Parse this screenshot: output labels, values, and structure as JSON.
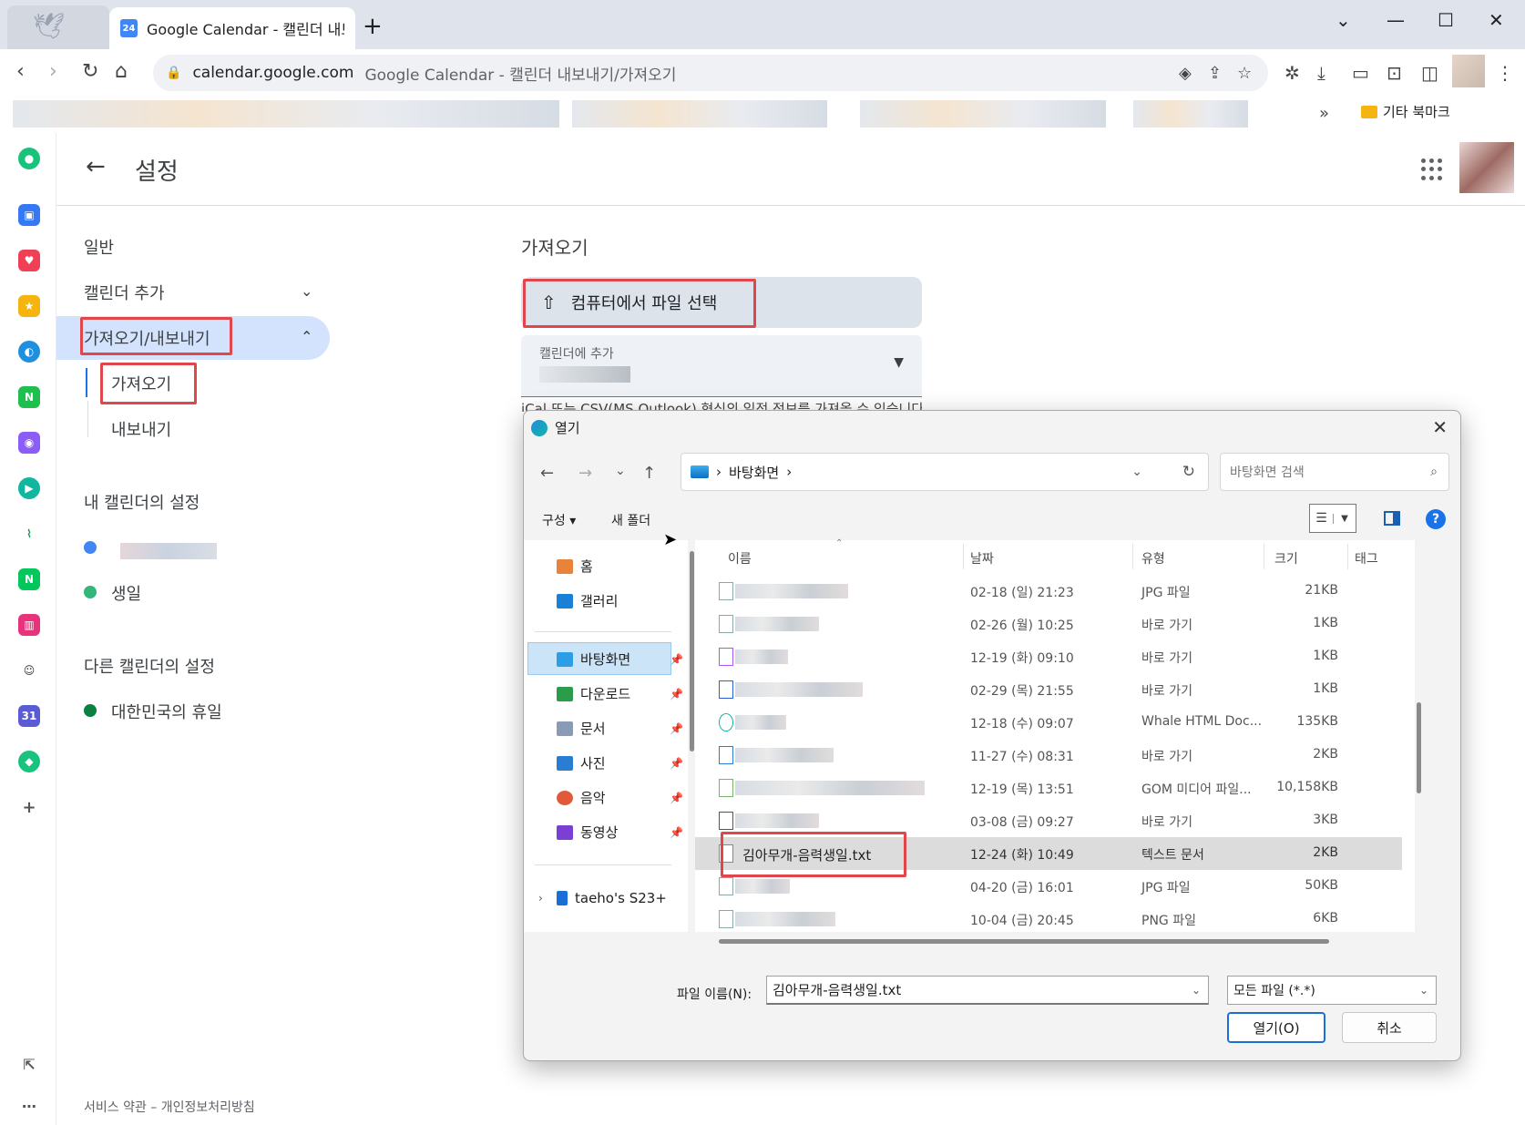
{
  "browser": {
    "tab_title": "Google Calendar - 캘린더 내보",
    "tab_favicon_text": "24",
    "new_tab": "+",
    "url_host": "calendar.google.com",
    "url_title": "Google Calendar - 캘린더 내보내기/가져오기",
    "bookmarks_more": "»",
    "other_bookmarks": "기타 북마크"
  },
  "settings": {
    "title": "설정",
    "nav": {
      "general": "일반",
      "add_calendar": "캘린더 추가",
      "import_export": "가져오기/내보내기",
      "import": "가져오기",
      "export": "내보내기",
      "my_calendars_settings": "내 캘린더의 설정",
      "birthday": "생일",
      "other_calendars_settings": "다른 캘린더의 설정",
      "korea_holidays": "대한민국의 휴일"
    },
    "footer": "서비스 약관 – 개인정보처리방침"
  },
  "import": {
    "heading": "가져오기",
    "select_file_button": "컴퓨터에서 파일 선택",
    "add_to_calendar_label": "캘린더에 추가",
    "note": "iCal 또는 CSV(MS Outlook) 형식의 일정 정보를 가져올 수 있습니다"
  },
  "dialog": {
    "title": "열기",
    "path": "바탕화면",
    "search_placeholder": "바탕화면 검색",
    "organize": "구성",
    "new_folder": "새 폴더",
    "columns": {
      "name": "이름",
      "date": "날짜",
      "type": "유형",
      "size": "크기",
      "tags": "태그"
    },
    "nav_items": [
      {
        "label": "홈",
        "icon": "home-icon",
        "color": "#e8833a"
      },
      {
        "label": "갤러리",
        "icon": "gallery-icon",
        "color": "#1a7fd6"
      },
      {
        "label": "바탕화면",
        "icon": "desktop-icon",
        "color": "#2b9ee6"
      },
      {
        "label": "다운로드",
        "icon": "download-icon",
        "color": "#2a9d4a"
      },
      {
        "label": "문서",
        "icon": "documents-icon",
        "color": "#8a9bb5"
      },
      {
        "label": "사진",
        "icon": "pictures-icon",
        "color": "#2b7cd3"
      },
      {
        "label": "음악",
        "icon": "music-icon",
        "color": "#e05a3a"
      },
      {
        "label": "동영상",
        "icon": "videos-icon",
        "color": "#7b3fd4"
      },
      {
        "label": "taeho's S23+",
        "icon": "phone-icon",
        "color": "#1a6fd6"
      }
    ],
    "files": [
      {
        "date": "02-18 (일) 21:23",
        "type": "JPG 파일",
        "size": "21KB"
      },
      {
        "date": "02-26 (월) 10:25",
        "type": "바로 가기",
        "size": "1KB"
      },
      {
        "date": "12-19 (화) 09:10",
        "type": "바로 가기",
        "size": "1KB"
      },
      {
        "date": "02-29 (목) 21:55",
        "type": "바로 가기",
        "size": "1KB"
      },
      {
        "date": "12-18 (수) 09:07",
        "type": "Whale HTML Doc...",
        "size": "135KB"
      },
      {
        "date": "11-27 (수) 08:31",
        "type": "바로 가기",
        "size": "2KB"
      },
      {
        "date": "12-19 (목) 13:51",
        "type": "GOM 미디어 파일...",
        "size": "10,158KB"
      },
      {
        "date": "03-08 (금) 09:27",
        "type": "바로 가기",
        "size": "3KB"
      },
      {
        "name": "김아무개-음력생일.txt",
        "date": "12-24 (화) 10:49",
        "type": "텍스트 문서",
        "size": "2KB"
      },
      {
        "date": "04-20 (금) 16:01",
        "type": "JPG 파일",
        "size": "50KB"
      },
      {
        "date": "10-04 (금) 20:45",
        "type": "PNG 파일",
        "size": "6KB"
      }
    ],
    "filename_label": "파일 이름(N):",
    "filename_value": "김아무개-음력생일.txt",
    "filetype_value": "모든 파일 (*.*)",
    "open_button": "열기(O)",
    "cancel_button": "취소"
  },
  "colors": {
    "accent": "#1a73e8",
    "active_nav_bg": "#d3e3fd",
    "highlight_box": "#e0474c"
  }
}
